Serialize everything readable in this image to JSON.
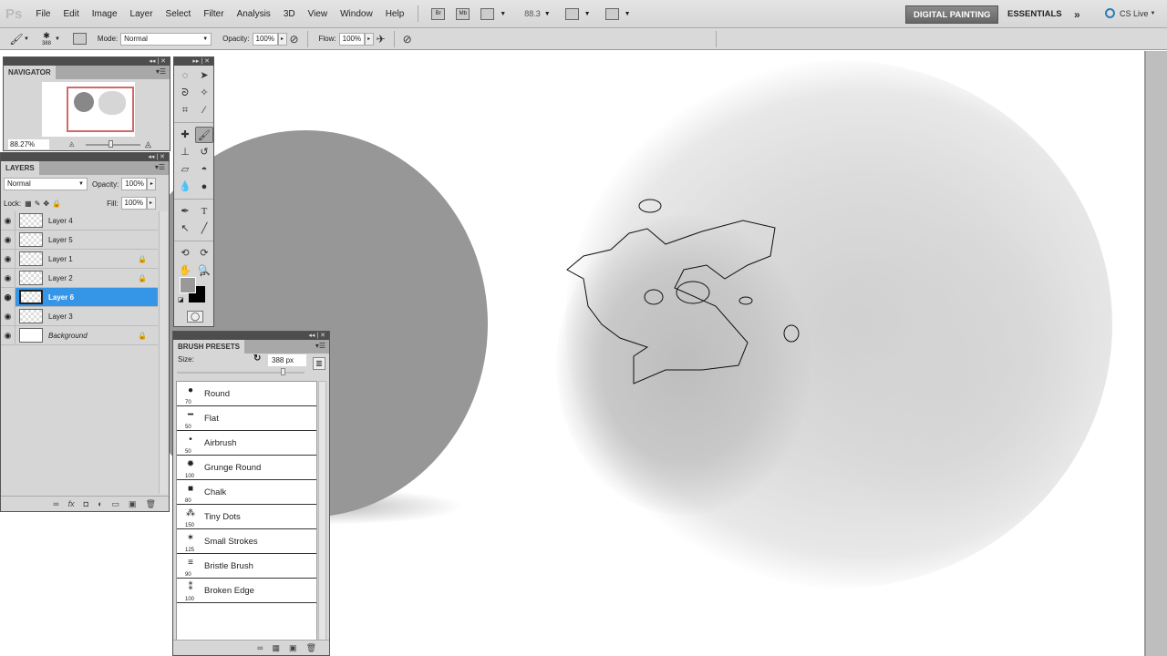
{
  "app": {
    "logo": "Ps"
  },
  "menu": [
    "File",
    "Edit",
    "Image",
    "Layer",
    "Select",
    "Filter",
    "Analysis",
    "3D",
    "View",
    "Window",
    "Help"
  ],
  "menu_icons": {
    "bridge": "Br",
    "minibridge": "Mb",
    "zoom_level": "88.3"
  },
  "workspaces": {
    "active": "DIGITAL PAINTING",
    "other": "ESSENTIALS",
    "more": "»",
    "cslive": "CS Live"
  },
  "options": {
    "brush_size": "388",
    "mode_label": "Mode:",
    "mode_value": "Normal",
    "opacity_label": "Opacity:",
    "opacity_value": "100%",
    "flow_label": "Flow:",
    "flow_value": "100%"
  },
  "navigator": {
    "title": "NAVIGATOR",
    "zoom": "88.27%"
  },
  "layers": {
    "title": "LAYERS",
    "blend_mode": "Normal",
    "opacity_label": "Opacity:",
    "opacity_value": "100%",
    "lock_label": "Lock:",
    "fill_label": "Fill:",
    "fill_value": "100%",
    "items": [
      {
        "name": "Layer 4",
        "locked": false,
        "selected": false
      },
      {
        "name": "Layer 5",
        "locked": false,
        "selected": false
      },
      {
        "name": "Layer 1",
        "locked": true,
        "selected": false
      },
      {
        "name": "Layer 2",
        "locked": true,
        "selected": false
      },
      {
        "name": "Layer 6",
        "locked": false,
        "selected": true
      },
      {
        "name": "Layer 3",
        "locked": false,
        "selected": false
      },
      {
        "name": "Background",
        "locked": true,
        "selected": false
      }
    ]
  },
  "brush_presets": {
    "title": "BRUSH PRESETS",
    "size_label": "Size:",
    "size_value": "388 px",
    "items": [
      {
        "name": "Round",
        "size": "70",
        "glyph": "●"
      },
      {
        "name": "Flat",
        "size": "50",
        "glyph": "━"
      },
      {
        "name": "Airbrush",
        "size": "50",
        "glyph": "•"
      },
      {
        "name": "Grunge Round",
        "size": "100",
        "glyph": "✹"
      },
      {
        "name": "Chalk",
        "size": "80",
        "glyph": "■"
      },
      {
        "name": "Tiny Dots",
        "size": "150",
        "glyph": "⁂"
      },
      {
        "name": "Small Strokes",
        "size": "125",
        "glyph": "✶"
      },
      {
        "name": "Bristle Brush",
        "size": "90",
        "glyph": "≡"
      },
      {
        "name": "Broken Edge",
        "size": "100",
        "glyph": "⁑"
      }
    ]
  },
  "colors": {
    "foreground": "#999999",
    "background": "#000000",
    "selected_layer": "#3596e8"
  }
}
